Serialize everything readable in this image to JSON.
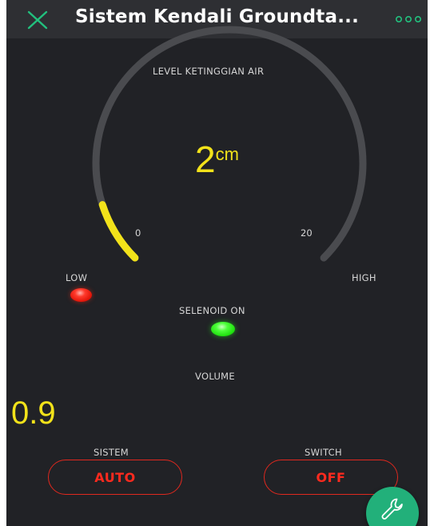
{
  "header": {
    "title": "Sistem Kendali Groundta...",
    "close_icon": "close-icon",
    "more_icon": "more-icon"
  },
  "gauge": {
    "label": "LEVEL KETINGGIAN AIR",
    "value": "2",
    "unit": "cm",
    "min_label": "0",
    "max_label": "20",
    "fraction": 0.1,
    "track_color": "#4a4b4f",
    "fill_color": "#f2e21a"
  },
  "indicators": {
    "low_label": "LOW",
    "high_label": "HIGH",
    "low_led_color": "#ff2a1e",
    "selenoid_label": "SELENOID ON",
    "selenoid_led_color": "#2cff1e"
  },
  "volume": {
    "label": "VOLUME",
    "value": "0.9"
  },
  "controls": {
    "sistem_label": "SISTEM",
    "sistem_button": "AUTO",
    "switch_label": "SWITCH",
    "switch_button": "OFF",
    "button_color": "#e0281e"
  },
  "fab": {
    "icon": "wrench-icon",
    "color": "#22b07a"
  },
  "colors": {
    "background": "#212226",
    "topbar": "#2e2f33",
    "accent": "#22b07a"
  }
}
